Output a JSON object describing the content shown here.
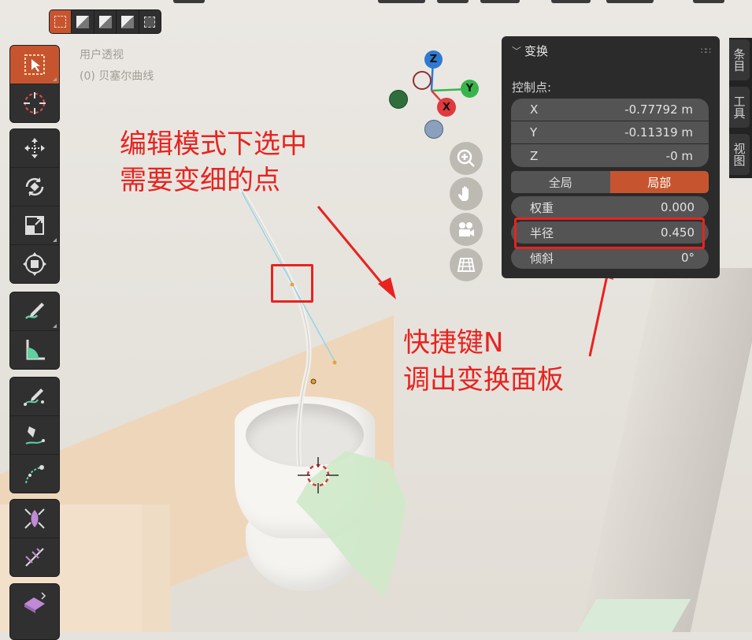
{
  "viewport": {
    "view_name": "用户透视",
    "object_name": "(0) 贝塞尔曲线"
  },
  "header": {
    "select_modes": [
      "select-box-new",
      "select-extend",
      "select-subtract",
      "select-intersect"
    ]
  },
  "toolbar": {
    "tools": [
      "select-box",
      "cursor",
      "move",
      "rotate",
      "scale",
      "transform",
      "annotate",
      "measure",
      "draw",
      "pen",
      "curve-tilt",
      "radius",
      "randomize",
      "extrude"
    ]
  },
  "gizmo": {
    "z": "Z",
    "y": "Y",
    "x": "X"
  },
  "annotations": {
    "left_line1": "编辑模式下选中",
    "left_line2": "需要变细的点",
    "right_line1": "快捷键N",
    "right_line2": "调出变换面板"
  },
  "transform_panel": {
    "title": "变换",
    "section_label": "控制点:",
    "x_label": "X",
    "x_value": "-0.77792 m",
    "y_label": "Y",
    "y_value": "-0.11319 m",
    "z_label": "Z",
    "z_value": "-0 m",
    "global_label": "全局",
    "local_label": "局部",
    "weight_label": "权重",
    "weight_value": "0.000",
    "radius_label": "半径",
    "radius_value": "0.450",
    "tilt_label": "倾斜",
    "tilt_value": "0°"
  },
  "side_tabs": [
    "条目",
    "工具",
    "视图"
  ],
  "colors": {
    "accent": "#c6552f",
    "annotation": "#e8231f",
    "axis_x": "#e03a3e",
    "axis_y": "#38b54a",
    "axis_z": "#2f7ad1"
  }
}
